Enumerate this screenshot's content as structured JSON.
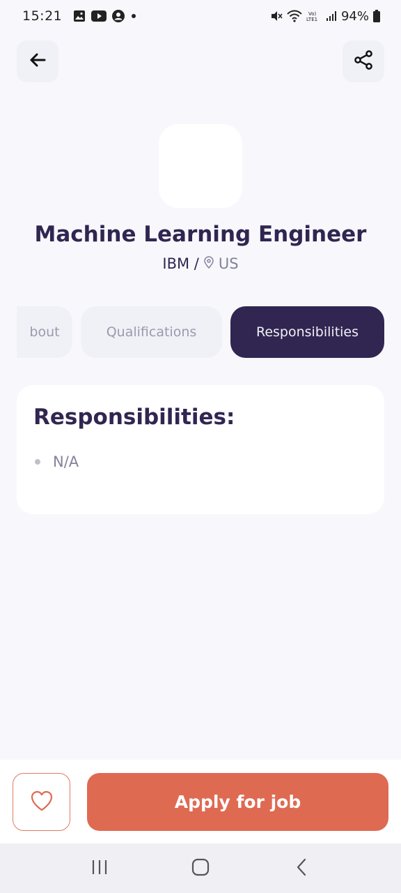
{
  "status_bar": {
    "time": "15:21",
    "battery": "94%",
    "notification_icons": [
      "image-icon",
      "youtube-icon",
      "account-icon",
      "dot-icon"
    ],
    "system_icons": [
      "mute-icon",
      "wifi-icon",
      "volte-icon",
      "signal-icon",
      "battery-icon"
    ]
  },
  "header": {
    "back_icon": "arrow-left-icon",
    "share_icon": "share-icon"
  },
  "job": {
    "title": "Machine Learning Engineer",
    "company": "IBM /",
    "location": "US"
  },
  "tabs": [
    {
      "label": "bout",
      "active": false
    },
    {
      "label": "Qualifications",
      "active": false
    },
    {
      "label": "Responsibilities",
      "active": true
    }
  ],
  "section": {
    "title": "Responsibilities:",
    "items": [
      "N/A"
    ]
  },
  "footer": {
    "favorite_icon": "heart-icon",
    "apply_label": "Apply for job"
  },
  "navbar": {
    "recent_icon": "recent-apps-icon",
    "home_icon": "home-icon",
    "back_icon": "nav-back-icon"
  },
  "colors": {
    "primary": "#312651",
    "accent": "#df6a52",
    "background": "#f8f8fc",
    "tab_inactive": "#f0f1f6",
    "muted_text": "#83829a"
  }
}
